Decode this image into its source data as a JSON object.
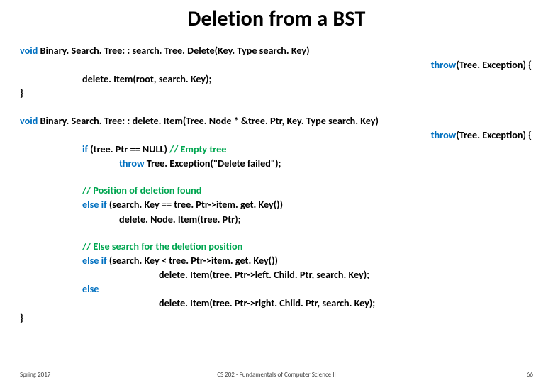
{
  "title": "Deletion from a BST",
  "code1": {
    "sig_prefix": "void",
    "sig_rest": " Binary. Search. Tree: : search. Tree. Delete(Key. Type search. Key)",
    "throw_kw": "throw",
    "throw_rest": "(Tree. Exception) {",
    "body": "delete. Item(root, search. Key);",
    "close": "}"
  },
  "code2": {
    "sig_prefix": "void",
    "sig_rest": " Binary. Search. Tree: : delete. Item(Tree. Node * &tree. Ptr, Key. Type search. Key)",
    "throw_kw": "throw",
    "throw_rest": "(Tree. Exception) {",
    "if_kw": "if",
    "if_cond": " (tree. Ptr == NULL) ",
    "if_comment": "// Empty tree",
    "throw_stmt_kw": "throw",
    "throw_stmt_rest": " Tree. Exception(\"Delete failed\");",
    "pos_comment": "// Position of deletion found",
    "elseif1_kw": "else if",
    "elseif1_cond": " (search. Key == tree. Ptr->item. get. Key())",
    "elseif1_body": "delete. Node. Item(tree. Ptr);",
    "else_comment": "// Else search for the deletion position",
    "elseif2_kw": "else if",
    "elseif2_cond": " (search. Key < tree. Ptr->item. get. Key())",
    "elseif2_body": "delete. Item(tree. Ptr->left. Child. Ptr, search. Key);",
    "else_kw": "else",
    "else_body": "delete. Item(tree. Ptr->right. Child. Ptr, search. Key);",
    "close": "}"
  },
  "footer": {
    "left": "Spring 2017",
    "center": "CS 202 - Fundamentals of Computer Science II",
    "right": "66"
  }
}
